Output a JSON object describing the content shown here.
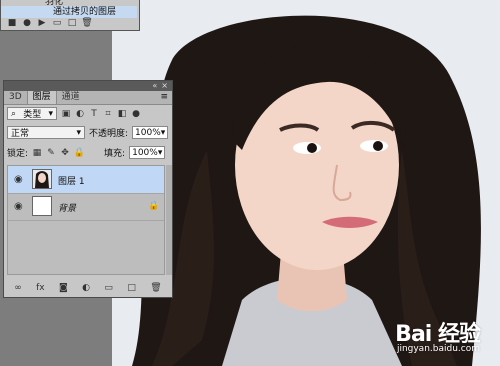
{
  "top_panel": {
    "row1_text": "羽化",
    "row2_text": "通过拷贝的图层",
    "toolbar_icons": [
      "stop-icon",
      "record-icon",
      "play-icon",
      "folder-icon",
      "new-icon",
      "trash-icon"
    ]
  },
  "layers_panel": {
    "tabs": [
      {
        "label": "3D",
        "active": false
      },
      {
        "label": "图层",
        "active": true
      },
      {
        "label": "通道",
        "active": false
      }
    ],
    "filter": {
      "label": "类型",
      "icons": [
        "image-filter-icon",
        "adjust-filter-icon",
        "type-filter-icon",
        "shape-filter-icon",
        "smart-filter-icon",
        "toggle-filter-icon"
      ]
    },
    "blend_mode": "正常",
    "opacity_label": "不透明度:",
    "opacity_value": "100%",
    "lock_label": "锁定:",
    "fill_label": "填充:",
    "fill_value": "100%",
    "layers": [
      {
        "name": "图层 1",
        "selected": true,
        "visible": true,
        "locked": false
      },
      {
        "name": "背景",
        "selected": false,
        "visible": true,
        "locked": true
      }
    ],
    "bottom_icons": [
      "link-icon",
      "fx-icon",
      "mask-icon",
      "adjustment-icon",
      "group-icon",
      "new-layer-icon",
      "delete-icon"
    ]
  },
  "watermark": {
    "brand": "Bai 经验",
    "url": "jingyan.baidu.com"
  },
  "colors": {
    "panel_bg": "#c7c7c7",
    "selected_row": "#c0d7f5",
    "canvas_bg": "#7d7d7d"
  }
}
